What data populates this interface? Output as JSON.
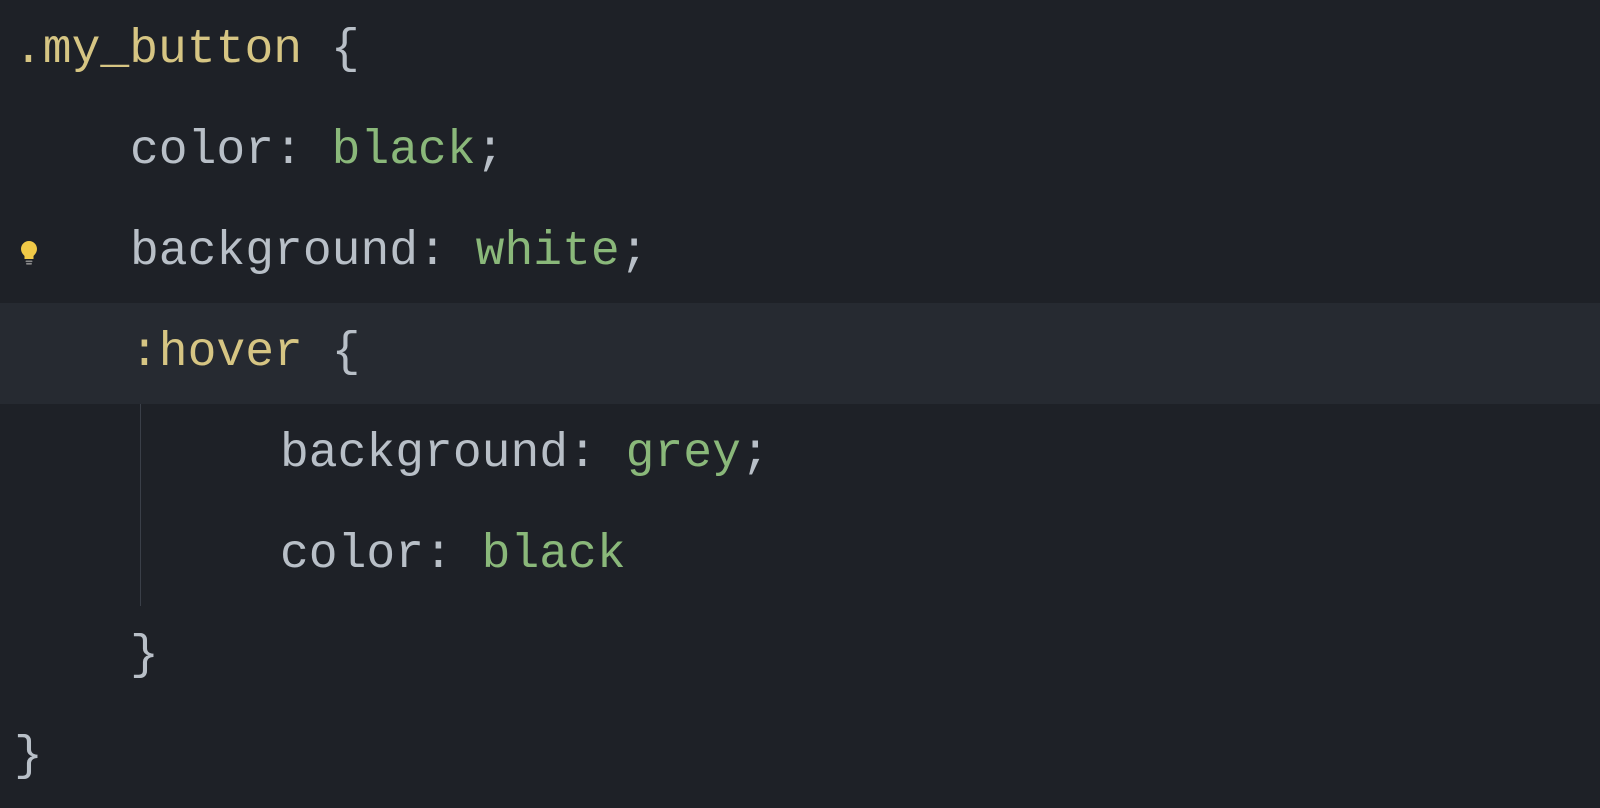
{
  "code": {
    "selector": ".my_button",
    "brace_open": " {",
    "brace_close": "}",
    "decl1_prop": "color",
    "decl1_colon": ": ",
    "decl1_value": "black",
    "decl1_semi": ";",
    "decl2_prop": "background",
    "decl2_colon": ": ",
    "decl2_value": "white",
    "decl2_semi": ";",
    "pseudo": ":hover",
    "pseudo_brace_open": " {",
    "decl3_prop": "background",
    "decl3_colon": ": ",
    "decl3_value": "grey",
    "decl3_semi": ";",
    "decl4_prop": "color",
    "decl4_colon": ": ",
    "decl4_value": "black",
    "inner_brace_close": "}"
  },
  "icons": {
    "bulb": "lightbulb"
  },
  "colors": {
    "bg": "#1e2127",
    "fg": "#b8bfc7",
    "selector": "#d6c583",
    "value": "#8ab87a",
    "highlight": "#262a31",
    "guide": "#3a3f48",
    "bulb": "#f0c947"
  }
}
